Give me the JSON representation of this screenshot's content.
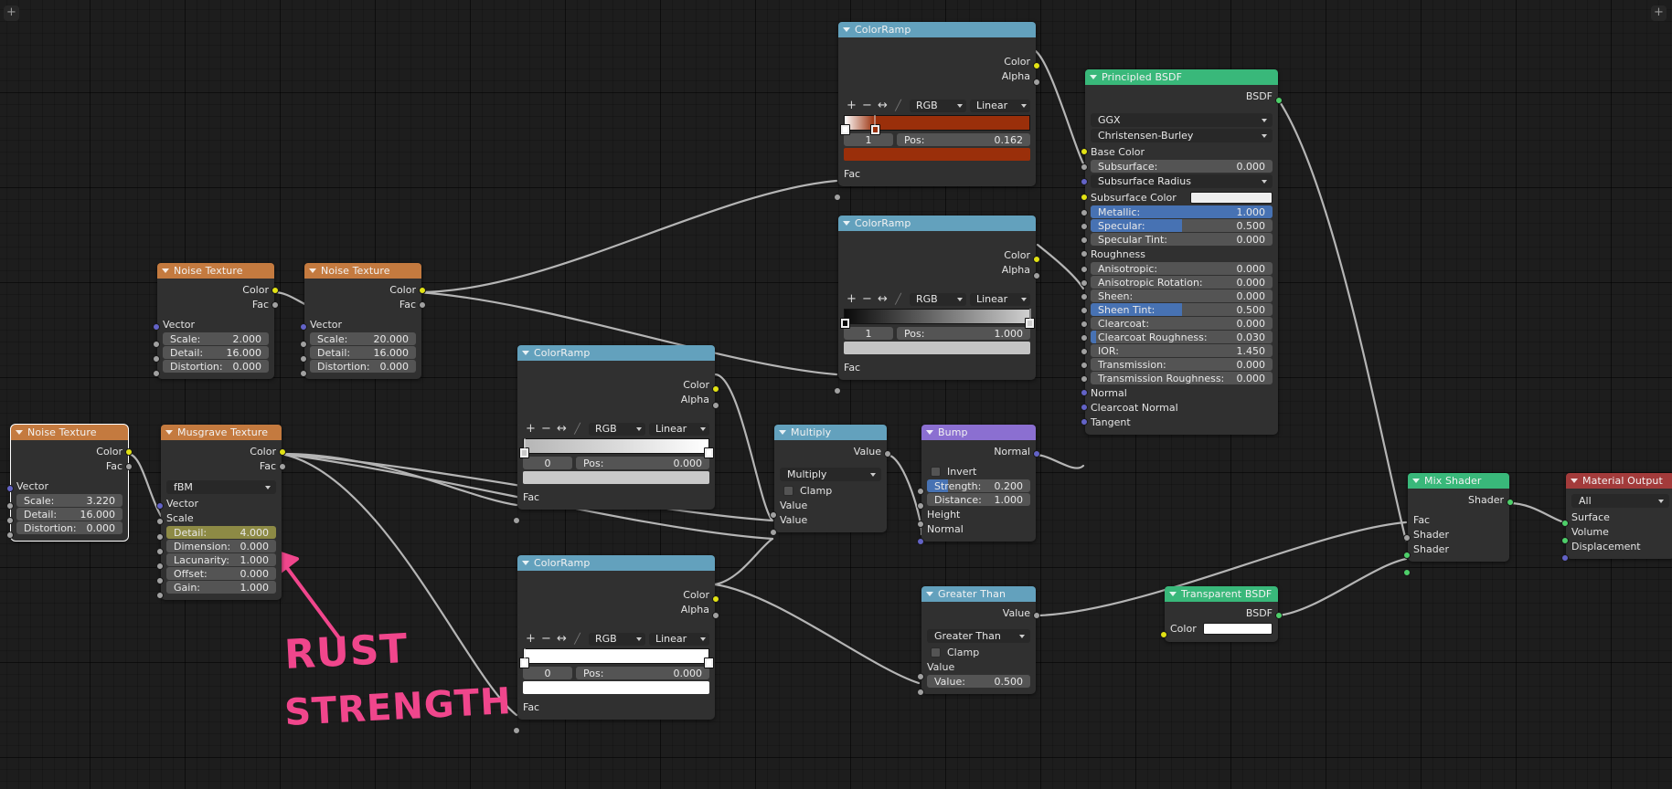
{
  "app": {
    "editor": "blender-shader-node-editor",
    "corner_toggle_label": "+"
  },
  "annotation": {
    "line1": "RUST",
    "line2": "STRENGTH",
    "color": "#f0468c"
  },
  "colors": {
    "header_texture": "#c47a3f",
    "header_converter": "#63a1bd",
    "header_shader": "#39b87a",
    "header_vector": "#8b6fd1",
    "header_output": "#a33b3b",
    "rust": "#9a2f0a",
    "highlight_blue": "#4772b3",
    "highlight_olive": "#8d8a45",
    "socket_color": "#e2e214",
    "socket_value": "#a1a1a1",
    "socket_vector": "#6363c7",
    "socket_shader": "#4ecf6a"
  },
  "nodes": {
    "noise1": {
      "title": "Noise Texture",
      "outputs": [
        "Color",
        "Fac"
      ],
      "inputs": [
        "Vector"
      ],
      "props": [
        {
          "name": "Scale:",
          "value": "2.000"
        },
        {
          "name": "Detail:",
          "value": "16.000"
        },
        {
          "name": "Distortion:",
          "value": "0.000"
        }
      ]
    },
    "noise2": {
      "title": "Noise Texture",
      "outputs": [
        "Color",
        "Fac"
      ],
      "inputs": [
        "Vector"
      ],
      "props": [
        {
          "name": "Scale:",
          "value": "20.000"
        },
        {
          "name": "Detail:",
          "value": "16.000"
        },
        {
          "name": "Distortion:",
          "value": "0.000"
        }
      ]
    },
    "noise3": {
      "title": "Noise Texture",
      "outputs": [
        "Color",
        "Fac"
      ],
      "inputs": [
        "Vector"
      ],
      "props": [
        {
          "name": "Scale:",
          "value": "3.220"
        },
        {
          "name": "Detail:",
          "value": "16.000"
        },
        {
          "name": "Distortion:",
          "value": "0.000"
        }
      ]
    },
    "musgrave": {
      "title": "Musgrave Texture",
      "outputs": [
        "Color",
        "Fac"
      ],
      "dropdown": "fBM",
      "inputs": [
        "Vector",
        "Scale"
      ],
      "props": [
        {
          "name": "Detail:",
          "value": "4.000",
          "highlight": "olive"
        },
        {
          "name": "Dimension:",
          "value": "0.000"
        },
        {
          "name": "Lacunarity:",
          "value": "1.000"
        },
        {
          "name": "Offset:",
          "value": "0.000"
        },
        {
          "name": "Gain:",
          "value": "1.000"
        }
      ]
    },
    "colorramp_top": {
      "title": "ColorRamp",
      "outputs": [
        "Color",
        "Alpha"
      ],
      "input": "Fac",
      "interpolation_mode": "RGB",
      "interpolation": "Linear",
      "index": "1",
      "pos_label": "Pos:",
      "pos_value": "0.162",
      "selected_color": "#9a2f0a",
      "stops": [
        {
          "position": 0.0,
          "color": "#ffffff"
        },
        {
          "position": 0.162,
          "color": "#9a2f0a"
        }
      ]
    },
    "colorramp_second": {
      "title": "ColorRamp",
      "outputs": [
        "Color",
        "Alpha"
      ],
      "input": "Fac",
      "interpolation_mode": "RGB",
      "interpolation": "Linear",
      "index": "1",
      "pos_label": "Pos:",
      "pos_value": "1.000",
      "selected_color": "#c4c4c4",
      "stops": [
        {
          "position": 0.0,
          "color": "#0a0a0a"
        },
        {
          "position": 1.0,
          "color": "#cfcfcf"
        }
      ]
    },
    "colorramp_mid": {
      "title": "ColorRamp",
      "outputs": [
        "Color",
        "Alpha"
      ],
      "input": "Fac",
      "interpolation_mode": "RGB",
      "interpolation": "Linear",
      "index": "0",
      "pos_label": "Pos:",
      "pos_value": "0.000",
      "selected_color": "#c9c9c9",
      "stops": [
        {
          "position": 0.0,
          "color": "#b5b5b5"
        },
        {
          "position": 1.0,
          "color": "#ffffff"
        }
      ]
    },
    "colorramp_bottom": {
      "title": "ColorRamp",
      "outputs": [
        "Color",
        "Alpha"
      ],
      "input": "Fac",
      "interpolation_mode": "RGB",
      "interpolation": "Linear",
      "index": "0",
      "pos_label": "Pos:",
      "pos_value": "0.000",
      "selected_color": "#ffffff",
      "stops": [
        {
          "position": 0.0,
          "color": "#ffffff"
        },
        {
          "position": 1.0,
          "color": "#ffffff"
        }
      ]
    },
    "multiply": {
      "title": "Multiply",
      "output": "Value",
      "operation": "Multiply",
      "clamp_label": "Clamp",
      "inputs": [
        "Value",
        "Value"
      ]
    },
    "bump": {
      "title": "Bump",
      "output": "Normal",
      "invert_label": "Invert",
      "props": [
        {
          "name": "Strength:",
          "value": "0.200",
          "highlight": "blue",
          "fill": 0.2
        },
        {
          "name": "Distance:",
          "value": "1.000"
        }
      ],
      "inputs": [
        "Height",
        "Normal"
      ]
    },
    "greater_than": {
      "title": "Greater Than",
      "output": "Value",
      "operation": "Greater Than",
      "clamp_label": "Clamp",
      "input_label": "Value",
      "prop": {
        "name": "Value:",
        "value": "0.500"
      }
    },
    "principled": {
      "title": "Principled BSDF",
      "output": "BSDF",
      "distribution": "GGX",
      "subsurface_method": "Christensen-Burley",
      "rows": [
        {
          "type": "label",
          "name": "Base Color",
          "socket": "yellow"
        },
        {
          "type": "value",
          "name": "Subsurface:",
          "value": "0.000",
          "socket": "gray"
        },
        {
          "type": "dropdown",
          "name": "Subsurface Radius",
          "socket": "purple"
        },
        {
          "type": "swatch",
          "name": "Subsurface Color",
          "socket": "yellow",
          "color": "#efefef"
        },
        {
          "type": "value",
          "name": "Metallic:",
          "value": "1.000",
          "socket": "gray",
          "highlight": "blue",
          "fill": 1.0
        },
        {
          "type": "value",
          "name": "Specular:",
          "value": "0.500",
          "socket": "gray",
          "highlight": "blue",
          "fill": 0.5
        },
        {
          "type": "value",
          "name": "Specular Tint:",
          "value": "0.000",
          "socket": "gray"
        },
        {
          "type": "label",
          "name": "Roughness",
          "socket": "gray"
        },
        {
          "type": "value",
          "name": "Anisotropic:",
          "value": "0.000",
          "socket": "gray"
        },
        {
          "type": "value",
          "name": "Anisotropic Rotation:",
          "value": "0.000",
          "socket": "gray"
        },
        {
          "type": "value",
          "name": "Sheen:",
          "value": "0.000",
          "socket": "gray"
        },
        {
          "type": "value",
          "name": "Sheen Tint:",
          "value": "0.500",
          "socket": "gray",
          "highlight": "blue",
          "fill": 0.5
        },
        {
          "type": "value",
          "name": "Clearcoat:",
          "value": "0.000",
          "socket": "gray"
        },
        {
          "type": "value",
          "name": "Clearcoat Roughness:",
          "value": "0.030",
          "socket": "gray",
          "highlight": "blue",
          "fill": 0.03
        },
        {
          "type": "value",
          "name": "IOR:",
          "value": "1.450",
          "socket": "gray"
        },
        {
          "type": "value",
          "name": "Transmission:",
          "value": "0.000",
          "socket": "gray"
        },
        {
          "type": "value",
          "name": "Transmission Roughness:",
          "value": "0.000",
          "socket": "gray"
        },
        {
          "type": "label",
          "name": "Normal",
          "socket": "purple"
        },
        {
          "type": "label",
          "name": "Clearcoat Normal",
          "socket": "purple"
        },
        {
          "type": "label",
          "name": "Tangent",
          "socket": "purple"
        }
      ]
    },
    "transparent": {
      "title": "Transparent BSDF",
      "output": "BSDF",
      "color_label": "Color",
      "color_value": "#ffffff"
    },
    "mix_shader": {
      "title": "Mix Shader",
      "output": "Shader",
      "inputs": [
        "Fac",
        "Shader",
        "Shader"
      ]
    },
    "material_output": {
      "title": "Material Output",
      "target": "All",
      "inputs": [
        "Surface",
        "Volume",
        "Displacement"
      ]
    }
  }
}
